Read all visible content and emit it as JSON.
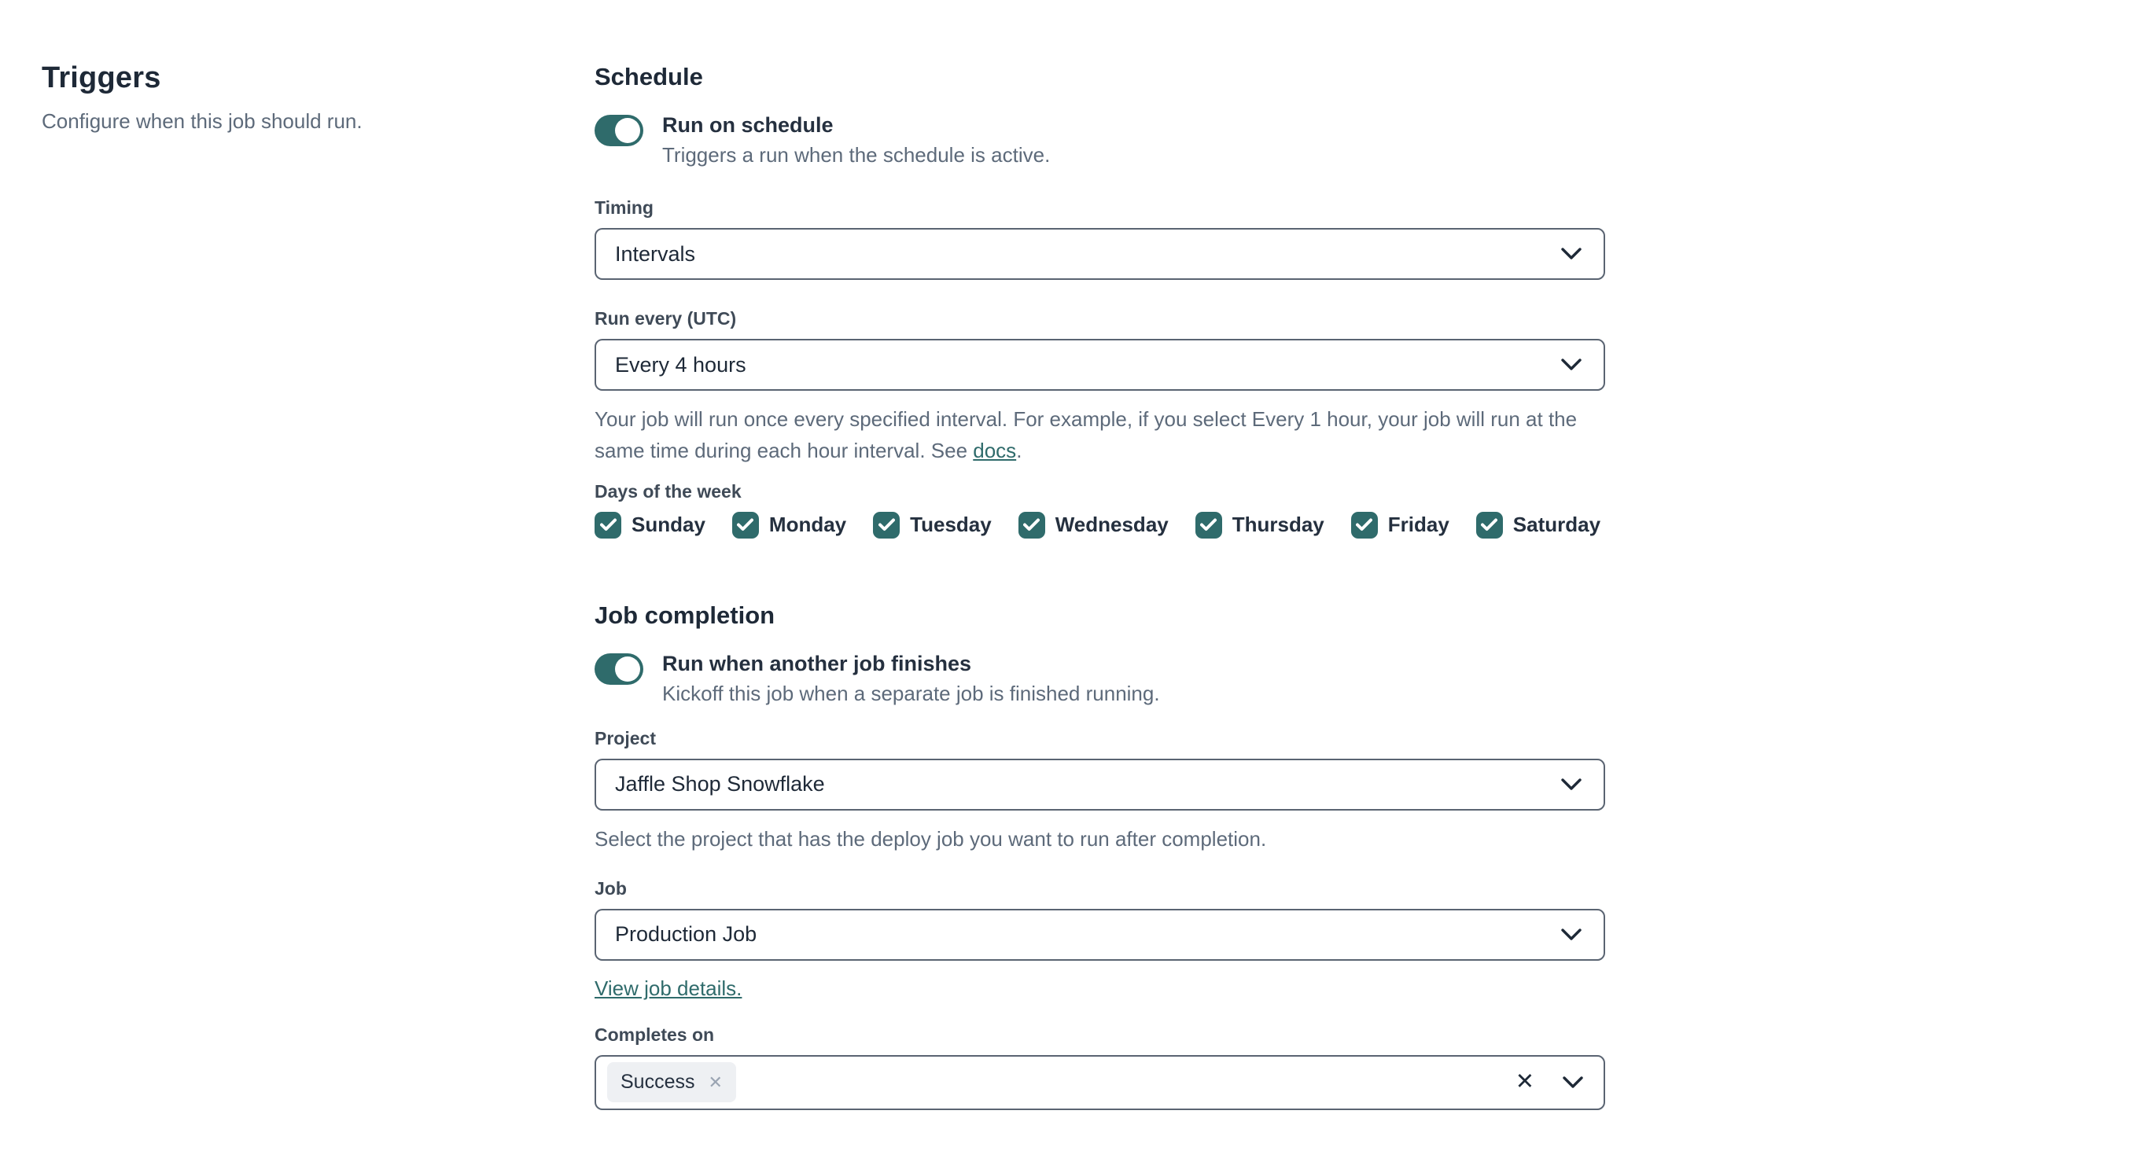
{
  "sidebar": {
    "title": "Triggers",
    "description": "Configure when this job should run."
  },
  "schedule": {
    "heading": "Schedule",
    "toggle": {
      "label": "Run on schedule",
      "description": "Triggers a run when the schedule is active.",
      "state": "on"
    },
    "timing": {
      "label": "Timing",
      "value": "Intervals"
    },
    "run_every": {
      "label": "Run every (UTC)",
      "value": "Every 4 hours",
      "help_prefix": "Your job will run once every specified interval. For example, if you select Every 1 hour, your job will run at the same time during each hour interval. See ",
      "help_link": "docs",
      "help_suffix": "."
    },
    "days": {
      "label": "Days of the week",
      "items": [
        {
          "label": "Sunday",
          "checked": true
        },
        {
          "label": "Monday",
          "checked": true
        },
        {
          "label": "Tuesday",
          "checked": true
        },
        {
          "label": "Wednesday",
          "checked": true
        },
        {
          "label": "Thursday",
          "checked": true
        },
        {
          "label": "Friday",
          "checked": true
        },
        {
          "label": "Saturday",
          "checked": true
        }
      ]
    }
  },
  "job_completion": {
    "heading": "Job completion",
    "toggle": {
      "label": "Run when another job finishes",
      "description": "Kickoff this job when a separate job is finished running.",
      "state": "on"
    },
    "project": {
      "label": "Project",
      "value": "Jaffle Shop Snowflake",
      "help": "Select the project that has the deploy job you want to run after completion."
    },
    "job": {
      "label": "Job",
      "value": "Production Job",
      "link_text": "View job details."
    },
    "completes_on": {
      "label": "Completes on",
      "chips": [
        {
          "label": "Success"
        }
      ]
    }
  },
  "icons": {
    "close_glyph": "✕",
    "chip_remove_glyph": "✕",
    "chevron_down": "chevron-down-icon",
    "check": "check-icon"
  },
  "colors": {
    "accent_teal": "#2f6b6b",
    "text_dark": "#1e2937",
    "text_muted": "#5d6a7a",
    "input_border": "#5a6472",
    "chip_background": "#eef0f3"
  }
}
